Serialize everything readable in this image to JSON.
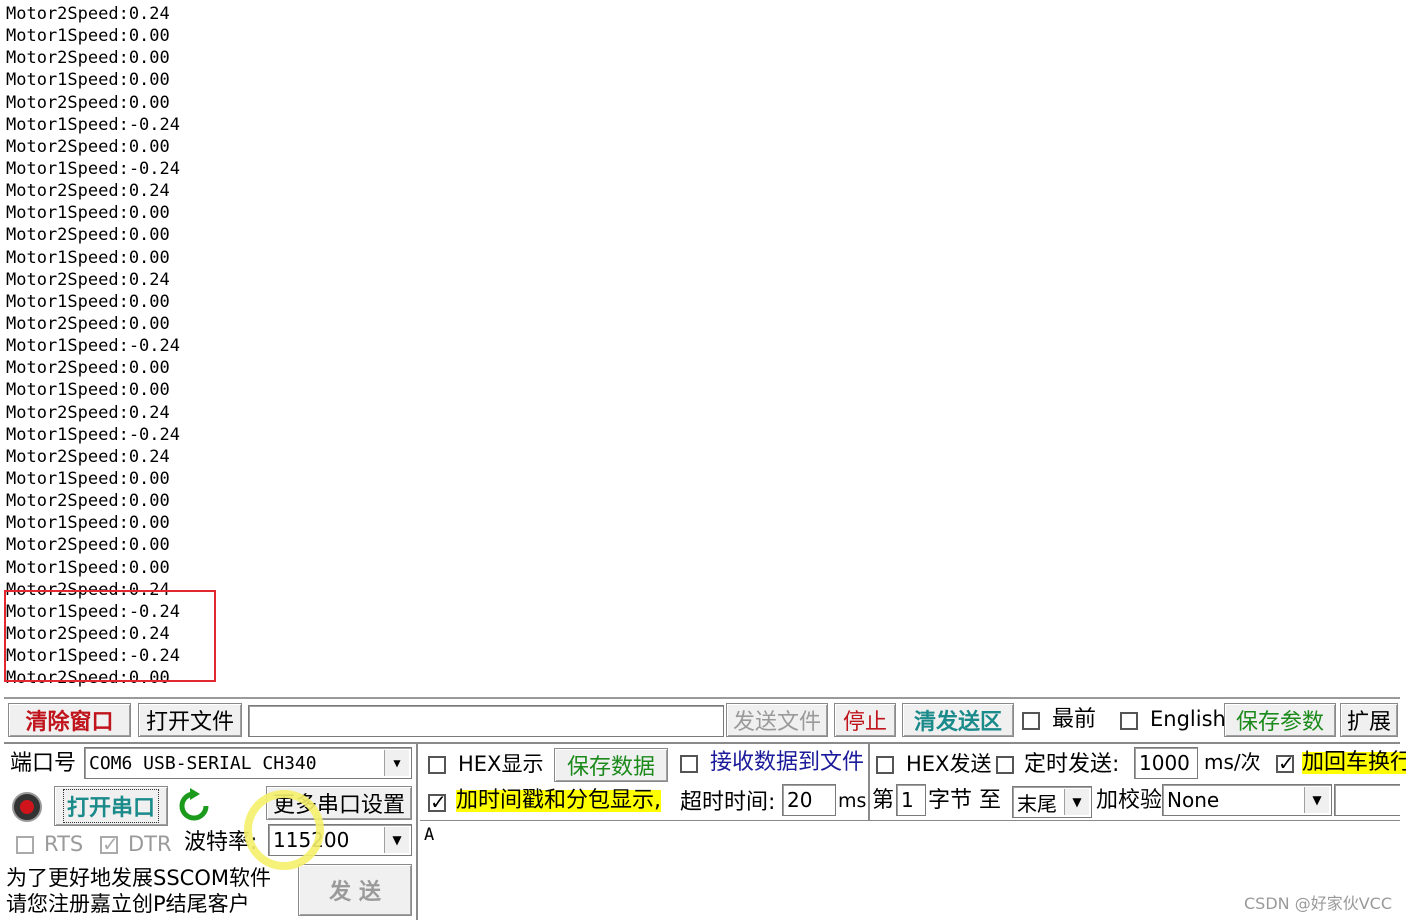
{
  "receive_log": [
    "Motor2Speed:0.24",
    "Motor1Speed:0.00",
    "Motor2Speed:0.00",
    "Motor1Speed:0.00",
    "Motor2Speed:0.00",
    "Motor1Speed:-0.24",
    "Motor2Speed:0.00",
    "Motor1Speed:-0.24",
    "Motor2Speed:0.24",
    "Motor1Speed:0.00",
    "Motor2Speed:0.00",
    "Motor1Speed:0.00",
    "Motor2Speed:0.24",
    "Motor1Speed:0.00",
    "Motor2Speed:0.00",
    "Motor1Speed:-0.24",
    "Motor2Speed:0.00",
    "Motor1Speed:0.00",
    "Motor2Speed:0.24",
    "Motor1Speed:-0.24",
    "Motor2Speed:0.24",
    "Motor1Speed:0.00",
    "Motor2Speed:0.00",
    "Motor1Speed:0.00",
    "Motor2Speed:0.00",
    "Motor1Speed:0.00",
    "Motor2Speed:0.24",
    "Motor1Speed:-0.24",
    "Motor2Speed:0.24",
    "Motor1Speed:-0.24",
    "Motor2Speed:0.00"
  ],
  "toolbar": {
    "clear_window": "清除窗口",
    "open_file": "打开文件",
    "file_path": "",
    "send_file": "发送文件",
    "stop": "停止",
    "clear_send": "清发送区",
    "topmost_label": "最前",
    "english_label": "English",
    "save_params": "保存参数",
    "expand": "扩展"
  },
  "port": {
    "label": "端口号",
    "value": "COM6 USB-SERIAL CH340",
    "open_button": "打开串口",
    "more_settings": "更多串口设置",
    "rts_label": "RTS",
    "dtr_label": "DTR",
    "baud_label": "波特率:",
    "baud_value": "115200"
  },
  "receive_options": {
    "hex_display": "HEX显示",
    "save_data": "保存数据",
    "receive_to_file": "接收数据到文件",
    "hex_send": "HEX发送",
    "timed_send": "定时发送:",
    "interval_value": "1000",
    "interval_unit": "ms/次",
    "append_crlf": "加回车换行",
    "timestamp": "加时间戳和分包显示,",
    "timeout_label": "超时时间:",
    "timeout_value": "20",
    "timeout_unit": "ms",
    "byte_prefix": "第",
    "byte_value": "1",
    "byte_suffix": "字节 至",
    "end_value": "末尾",
    "checksum_label": "加校验",
    "checksum_value": "None"
  },
  "send": {
    "input_text": "A",
    "send_button": "发 送"
  },
  "promo": {
    "line1": "为了更好地发展SSCOM软件",
    "line2": "请您注册嘉立创P结尾客户"
  },
  "watermark": "CSDN @好家伙VCC"
}
